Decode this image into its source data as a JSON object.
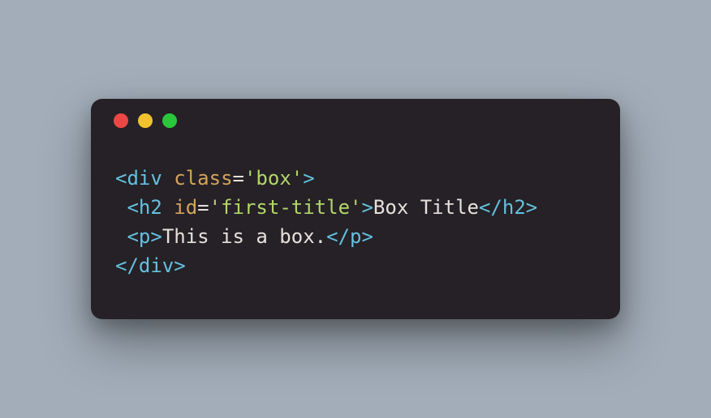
{
  "code": {
    "lines": [
      {
        "indent": 0,
        "open": true,
        "tag": "div",
        "attr": "class",
        "string": "'box'",
        "text": null,
        "closeTag": null
      },
      {
        "indent": 1,
        "open": true,
        "tag": "h2",
        "attr": "id",
        "string": "'first-title'",
        "text": "Box Title",
        "closeTag": "h2"
      },
      {
        "indent": 1,
        "open": true,
        "tag": "p",
        "attr": null,
        "string": null,
        "text": "This is a box.",
        "closeTag": "p"
      },
      {
        "indent": 0,
        "open": false,
        "tag": "div",
        "attr": null,
        "string": null,
        "text": null,
        "closeTag": null
      }
    ]
  }
}
